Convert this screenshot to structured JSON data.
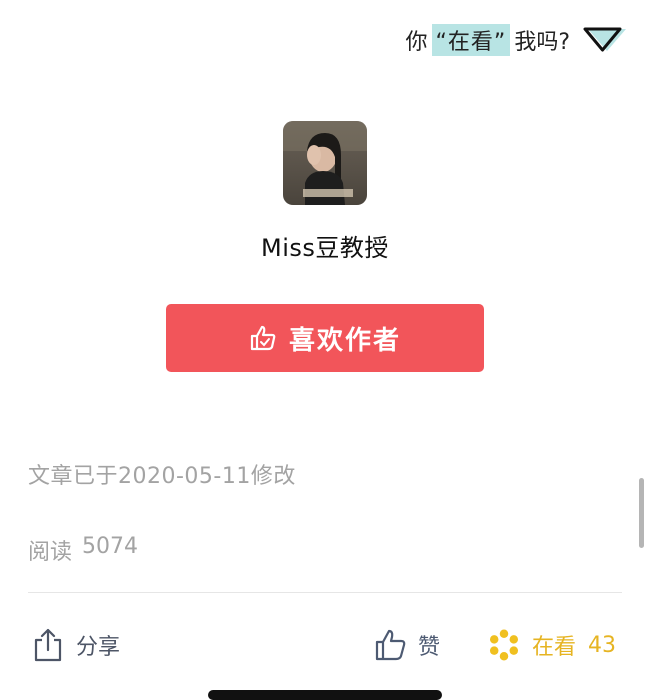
{
  "prompt": {
    "prefix": "你",
    "highlight": "“在看”",
    "suffix": "我吗?"
  },
  "author": {
    "name": "Miss豆教授"
  },
  "like_author_button": {
    "label": "喜欢作者"
  },
  "article": {
    "modified_note": "文章已于2020-05-11修改",
    "read_label": "阅读",
    "read_count": "5074"
  },
  "actions": {
    "share_label": "分享",
    "like_label": "赞",
    "viewing_label": "在看",
    "viewing_count": "43"
  },
  "colors": {
    "highlight_bg": "#b8e4e4",
    "button_red": "#f2555a",
    "viewing_gold": "#e6b422",
    "muted_text": "#a3a3a3"
  },
  "icons": {
    "triangle": "down-triangle-icon",
    "thumb": "thumbs-up-icon",
    "share": "share-icon",
    "viewing": "viewing-flower-icon"
  }
}
